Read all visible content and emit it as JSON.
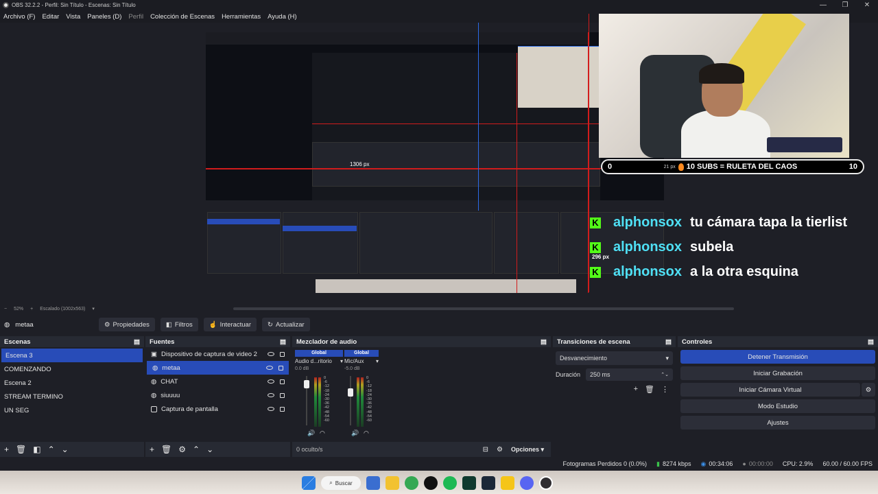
{
  "window": {
    "title": "OBS 32.2.2 - Perfil: Sin Título - Escenas: Sin Título"
  },
  "menu": [
    {
      "label": "Archivo (F)",
      "dim": false
    },
    {
      "label": "Editar",
      "dim": false
    },
    {
      "label": "Vista",
      "dim": false
    },
    {
      "label": "Paneles (D)",
      "dim": false
    },
    {
      "label": "Perfil",
      "dim": true
    },
    {
      "label": "Colección de Escenas",
      "dim": false
    },
    {
      "label": "Herramientas",
      "dim": false
    },
    {
      "label": "Ayuda (H)",
      "dim": false
    }
  ],
  "preview": {
    "subs_left": "0",
    "subs_px": "21 px",
    "subs_text": "10 SUBS = RULETA DEL CAOS",
    "subs_right": "10",
    "px_label": "296 px",
    "inner_px": "1306 px",
    "chat": [
      {
        "user": "alphonsox",
        "msg": "tu cámara tapa la tierlist"
      },
      {
        "user": "alphonsox",
        "msg": "subela"
      },
      {
        "user": "alphonsox",
        "msg": "a la otra esquina"
      }
    ],
    "zoom": "52%",
    "scale": "Escalado (1002x563)"
  },
  "source_toolbar": {
    "current": "metaa",
    "buttons": {
      "properties": "Propiedades",
      "filters": "Filtros",
      "interact": "Interactuar",
      "refresh": "Actualizar"
    }
  },
  "scenes": {
    "title": "Escenas",
    "items": [
      "Escena 3",
      "COMENZANDO",
      "Escena 2",
      "STREAM TERMINO",
      "UN SEG"
    ],
    "selected": 0
  },
  "sources": {
    "title": "Fuentes",
    "items": [
      "Dispositivo de captura de video 2",
      "metaa",
      "CHAT",
      "siuuuu",
      "Captura de pantalla"
    ],
    "selected": 1
  },
  "mixer": {
    "title": "Mezclador de audio",
    "channels": [
      {
        "global": "Global",
        "name": "Audio d...ritorio",
        "db": "0.0 dB",
        "level": 0.85
      },
      {
        "global": "Global",
        "name": "Mic/Aux",
        "db": "-5.0 dB",
        "level": 0.72
      }
    ],
    "ticks": [
      "0",
      "-6",
      "-12",
      "-18",
      "-24",
      "-30",
      "-36",
      "-42",
      "-48",
      "-54",
      "-60"
    ],
    "hidden": "0 oculto/s",
    "options": "Opciones"
  },
  "transitions": {
    "title": "Transiciones de escena",
    "selected": "Desvanecimiento",
    "duration_label": "Duración",
    "duration_value": "250 ms"
  },
  "controls": {
    "title": "Controles",
    "buttons": [
      "Detener Transmisión",
      "Iniciar Grabación",
      "Iniciar Cámara Virtual",
      "Modo Estudio",
      "Ajustes"
    ]
  },
  "status": {
    "dropped": "Fotogramas Perdidos 0 (0.0%)",
    "bitrate": "8274 kbps",
    "stream_time": "00:34:06",
    "rec_time": "00:00:00",
    "cpu": "CPU: 2.9%",
    "fps": "60.00 / 60.00 FPS"
  },
  "taskbar": {
    "search": "Buscar"
  },
  "colors": {
    "accent": "#284cb8",
    "chat_user": "#4fe0f5",
    "kick": "#53fc18"
  }
}
